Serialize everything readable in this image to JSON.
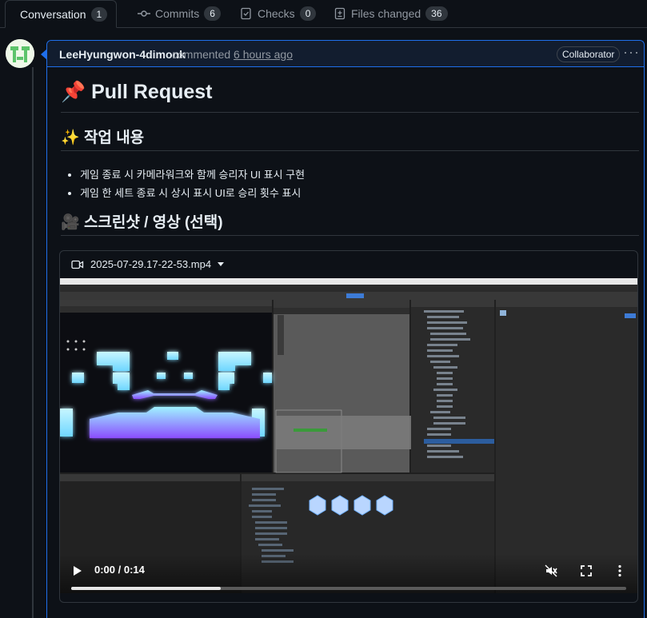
{
  "tabs": [
    {
      "label": "Conversation",
      "count": "1",
      "icon": "comment-discussion-icon"
    },
    {
      "label": "Commits",
      "count": "6",
      "icon": "git-commit-icon"
    },
    {
      "label": "Checks",
      "count": "0",
      "icon": "checklist-icon"
    },
    {
      "label": "Files changed",
      "count": "36",
      "icon": "file-diff-icon"
    }
  ],
  "comment": {
    "author": "LeeHyungwon-4dimonk",
    "action": "commented",
    "time": "6 hours ago",
    "badge": "Collaborator",
    "more": "···"
  },
  "body": {
    "title_emoji": "📌",
    "title": "Pull Request",
    "section1_emoji": "✨",
    "section1": "작업 내용",
    "items": [
      "게임 종료 시 카메라워크와 함께 승리자 UI 표시 구현",
      "게임 한 세트 종료 시 상시 표시 UI로 승리 횟수 표시"
    ],
    "section2_emoji": "🎥",
    "section2": "스크린샷 / 영상 (선택)"
  },
  "video": {
    "filename": "2025-07-29.17-22-53.mp4",
    "time": "0:00 / 0:14",
    "progress": 0.27,
    "colors": {
      "accent": "#1f6feb",
      "glow": "#7fe7ff",
      "purple": "#8a4dff"
    }
  }
}
